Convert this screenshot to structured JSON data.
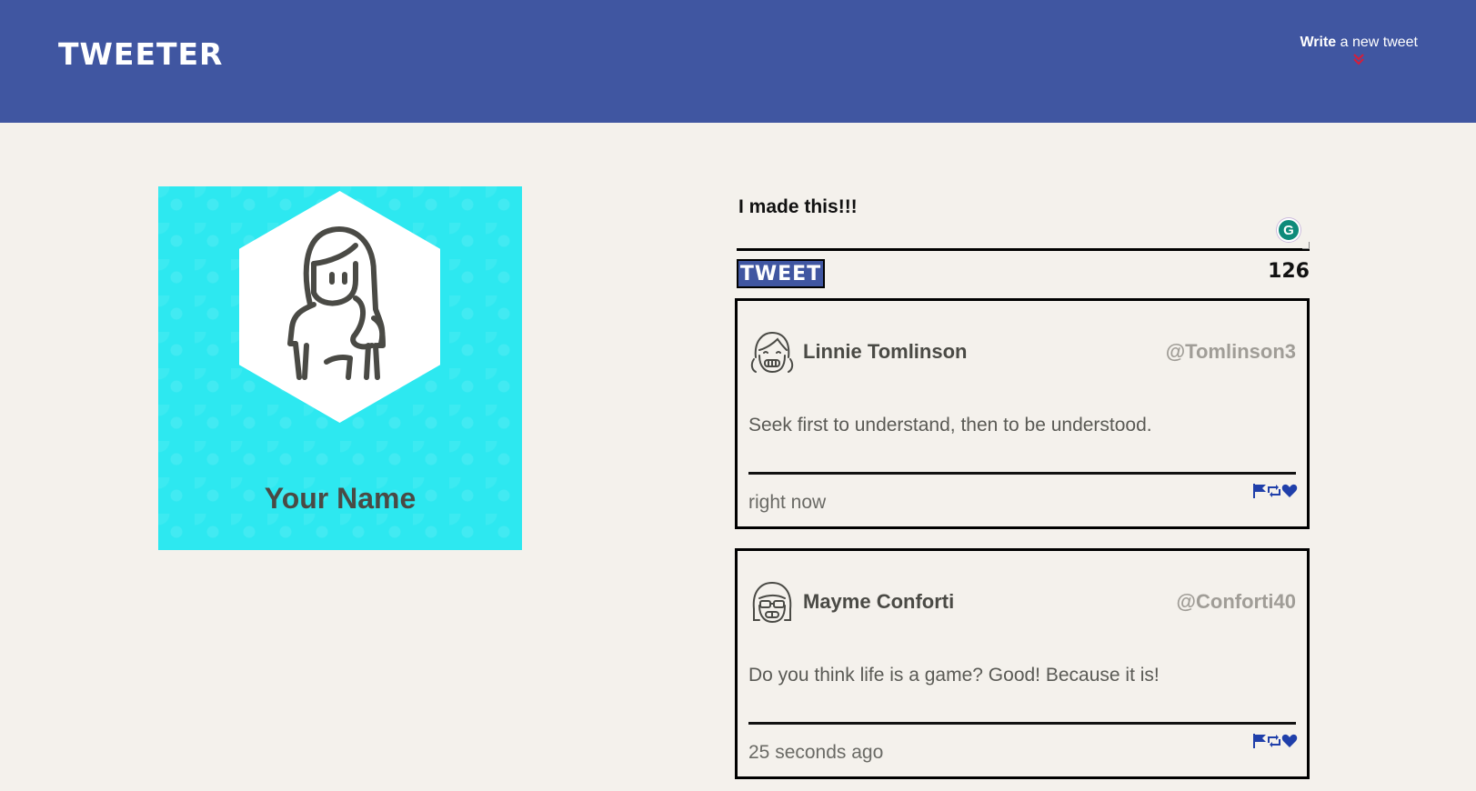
{
  "nav": {
    "logo": "TWEETER",
    "compose_bold": "Write",
    "compose_rest": " a new tweet",
    "compose_chevron": "»"
  },
  "profile": {
    "name": "Your Name"
  },
  "compose": {
    "text": "I made this!!!",
    "button_label": "TWEET",
    "counter": "126",
    "grammarly_glyph": "G"
  },
  "tweets": [
    {
      "author": "Linnie Tomlinson",
      "handle": "@Tomlinson3",
      "content": "Seek first to understand, then to be understood.",
      "timestamp": "right now",
      "avatar_icon": "smiling-girl-avatar-icon"
    },
    {
      "author": "Mayme Conforti",
      "handle": "@Conforti40",
      "content": "Do you think life is a game? Good! Because it is!",
      "timestamp": "25 seconds ago",
      "avatar_icon": "glasses-girl-avatar-icon"
    }
  ],
  "colors": {
    "nav_bg": "#4056a1",
    "page_bg": "#f4f1ec",
    "profile_bg": "#2de8f0",
    "action_icon": "#1f3faa",
    "chevron": "#d21f3c"
  }
}
